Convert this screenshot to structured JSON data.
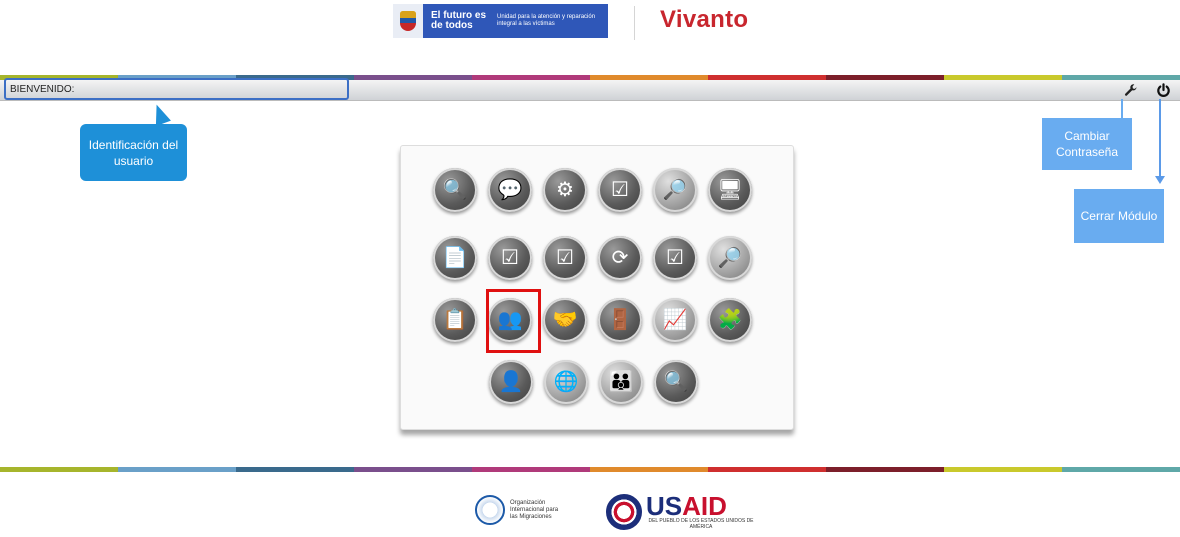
{
  "header": {
    "gov_logo_line1": "El futuro es de todos",
    "gov_logo_line2": "Unidad para la atención y reparación integral a las víctimas",
    "brand": "Vivanto"
  },
  "bar": {
    "welcome_label": "BIENVENIDO:",
    "change_password_icon": "wrench-icon",
    "close_module_icon": "power-icon"
  },
  "callouts": {
    "user_id": "Identificación del usuario",
    "change_password": "Cambiar Contraseña",
    "close_module": "Cerrar Módulo"
  },
  "stripe_colors": [
    "#a6b52c",
    "#6aa0c8",
    "#3a6a8c",
    "#7a4f8c",
    "#b03a7a",
    "#e08a2c",
    "#cf2f2f",
    "#7c1f2a",
    "#c9c92c",
    "#5fa8a8"
  ],
  "modules": [
    {
      "icon": "search-user-icon"
    },
    {
      "icon": "chat-icon"
    },
    {
      "icon": "user-settings-icon"
    },
    {
      "icon": "checklist-icon"
    },
    {
      "icon": "search-group-icon"
    },
    {
      "icon": "computer-icon"
    },
    {
      "icon": "document-icon"
    },
    {
      "icon": "checklist-icon"
    },
    {
      "icon": "checklist-icon"
    },
    {
      "icon": "refresh-icon"
    },
    {
      "icon": "checklist-icon"
    },
    {
      "icon": "search-group-icon"
    },
    {
      "icon": "document-list-icon"
    },
    {
      "icon": "group-icon",
      "selected": true
    },
    {
      "icon": "handshake-icon"
    },
    {
      "icon": "door-exit-icon"
    },
    {
      "icon": "growth-chart-icon"
    },
    {
      "icon": "puzzle-icon"
    },
    {
      "icon": "user-sync-icon"
    },
    {
      "icon": "globe-network-icon"
    },
    {
      "icon": "community-icon"
    },
    {
      "icon": "search-chart-icon"
    }
  ],
  "footer": {
    "oim_text": "Organización Internacional para las Migraciones",
    "usaid_text_1": "US",
    "usaid_text_2": "AID",
    "usaid_sub": "DEL PUEBLO DE LOS ESTADOS UNIDOS DE AMÉRICA"
  }
}
